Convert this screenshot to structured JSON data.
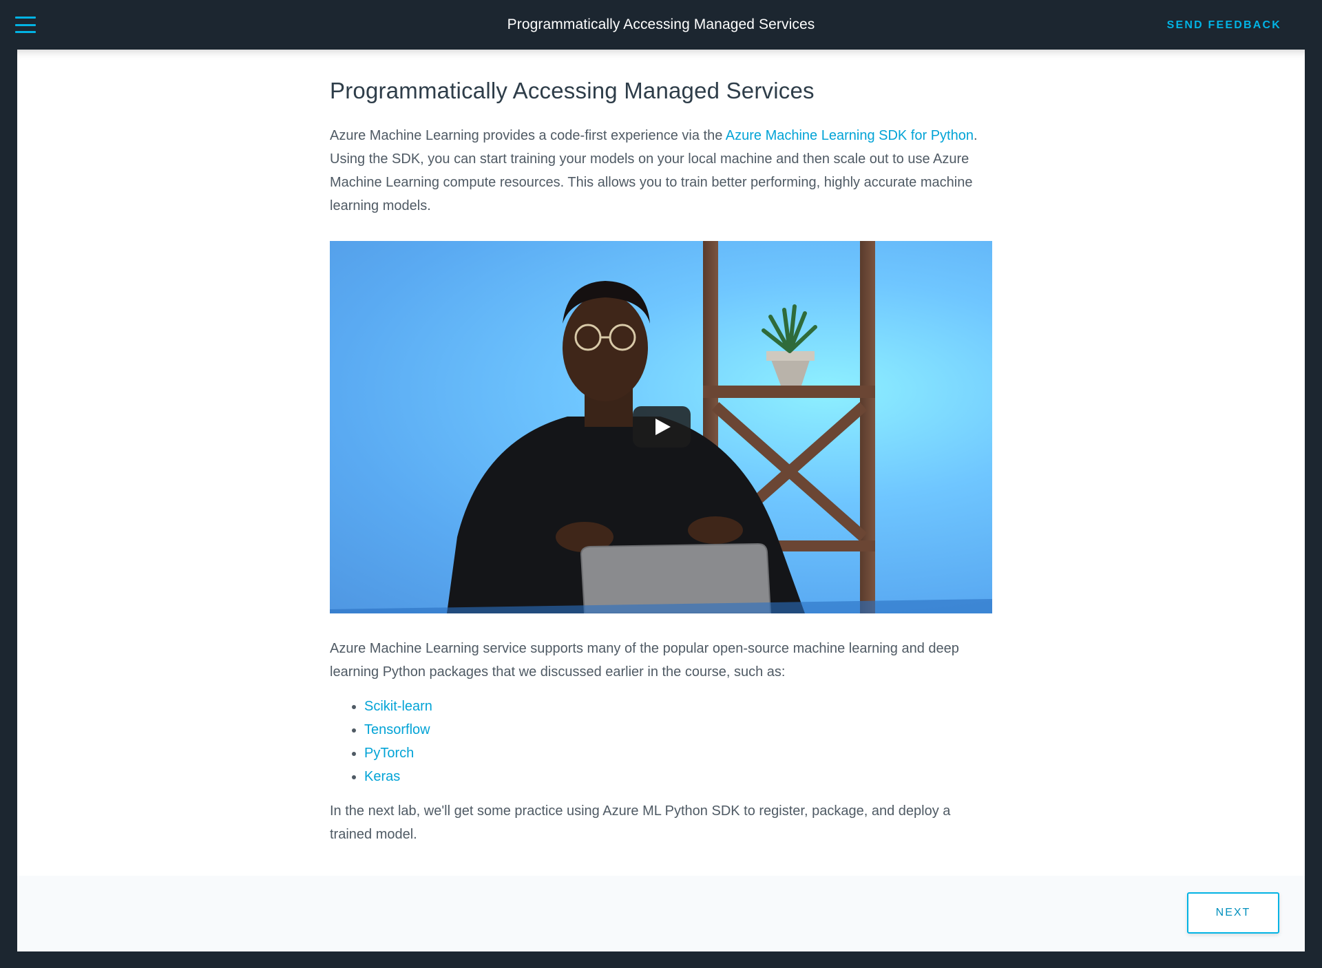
{
  "header": {
    "title": "Programmatically Accessing Managed Services",
    "feedback_label": "SEND FEEDBACK"
  },
  "article": {
    "heading": "Programmatically Accessing Managed Services",
    "intro_before_link": "Azure Machine Learning provides a code-first experience via the ",
    "intro_link": "Azure Machine Learning SDK for Python",
    "intro_after_link": ". Using the SDK, you can start training your models on your local machine and then scale out to use Azure Machine Learning compute resources. This allows you to train better performing, highly accurate machine learning models.",
    "packages_intro": "Azure Machine Learning service supports many of the popular open-source machine learning and deep learning Python packages that we discussed earlier in the course, such as:",
    "packages": [
      "Scikit-learn",
      "Tensorflow",
      "PyTorch",
      "Keras"
    ],
    "closing": "In the next lab, we'll get some practice using Azure ML Python SDK to register, package, and deploy a trained model."
  },
  "footer": {
    "next_label": "NEXT"
  },
  "colors": {
    "accent": "#02b3e4",
    "topbar": "#1c2630",
    "heading": "#2e3d49"
  },
  "icons": {
    "menu": "hamburger-menu-icon",
    "play": "play-icon"
  }
}
